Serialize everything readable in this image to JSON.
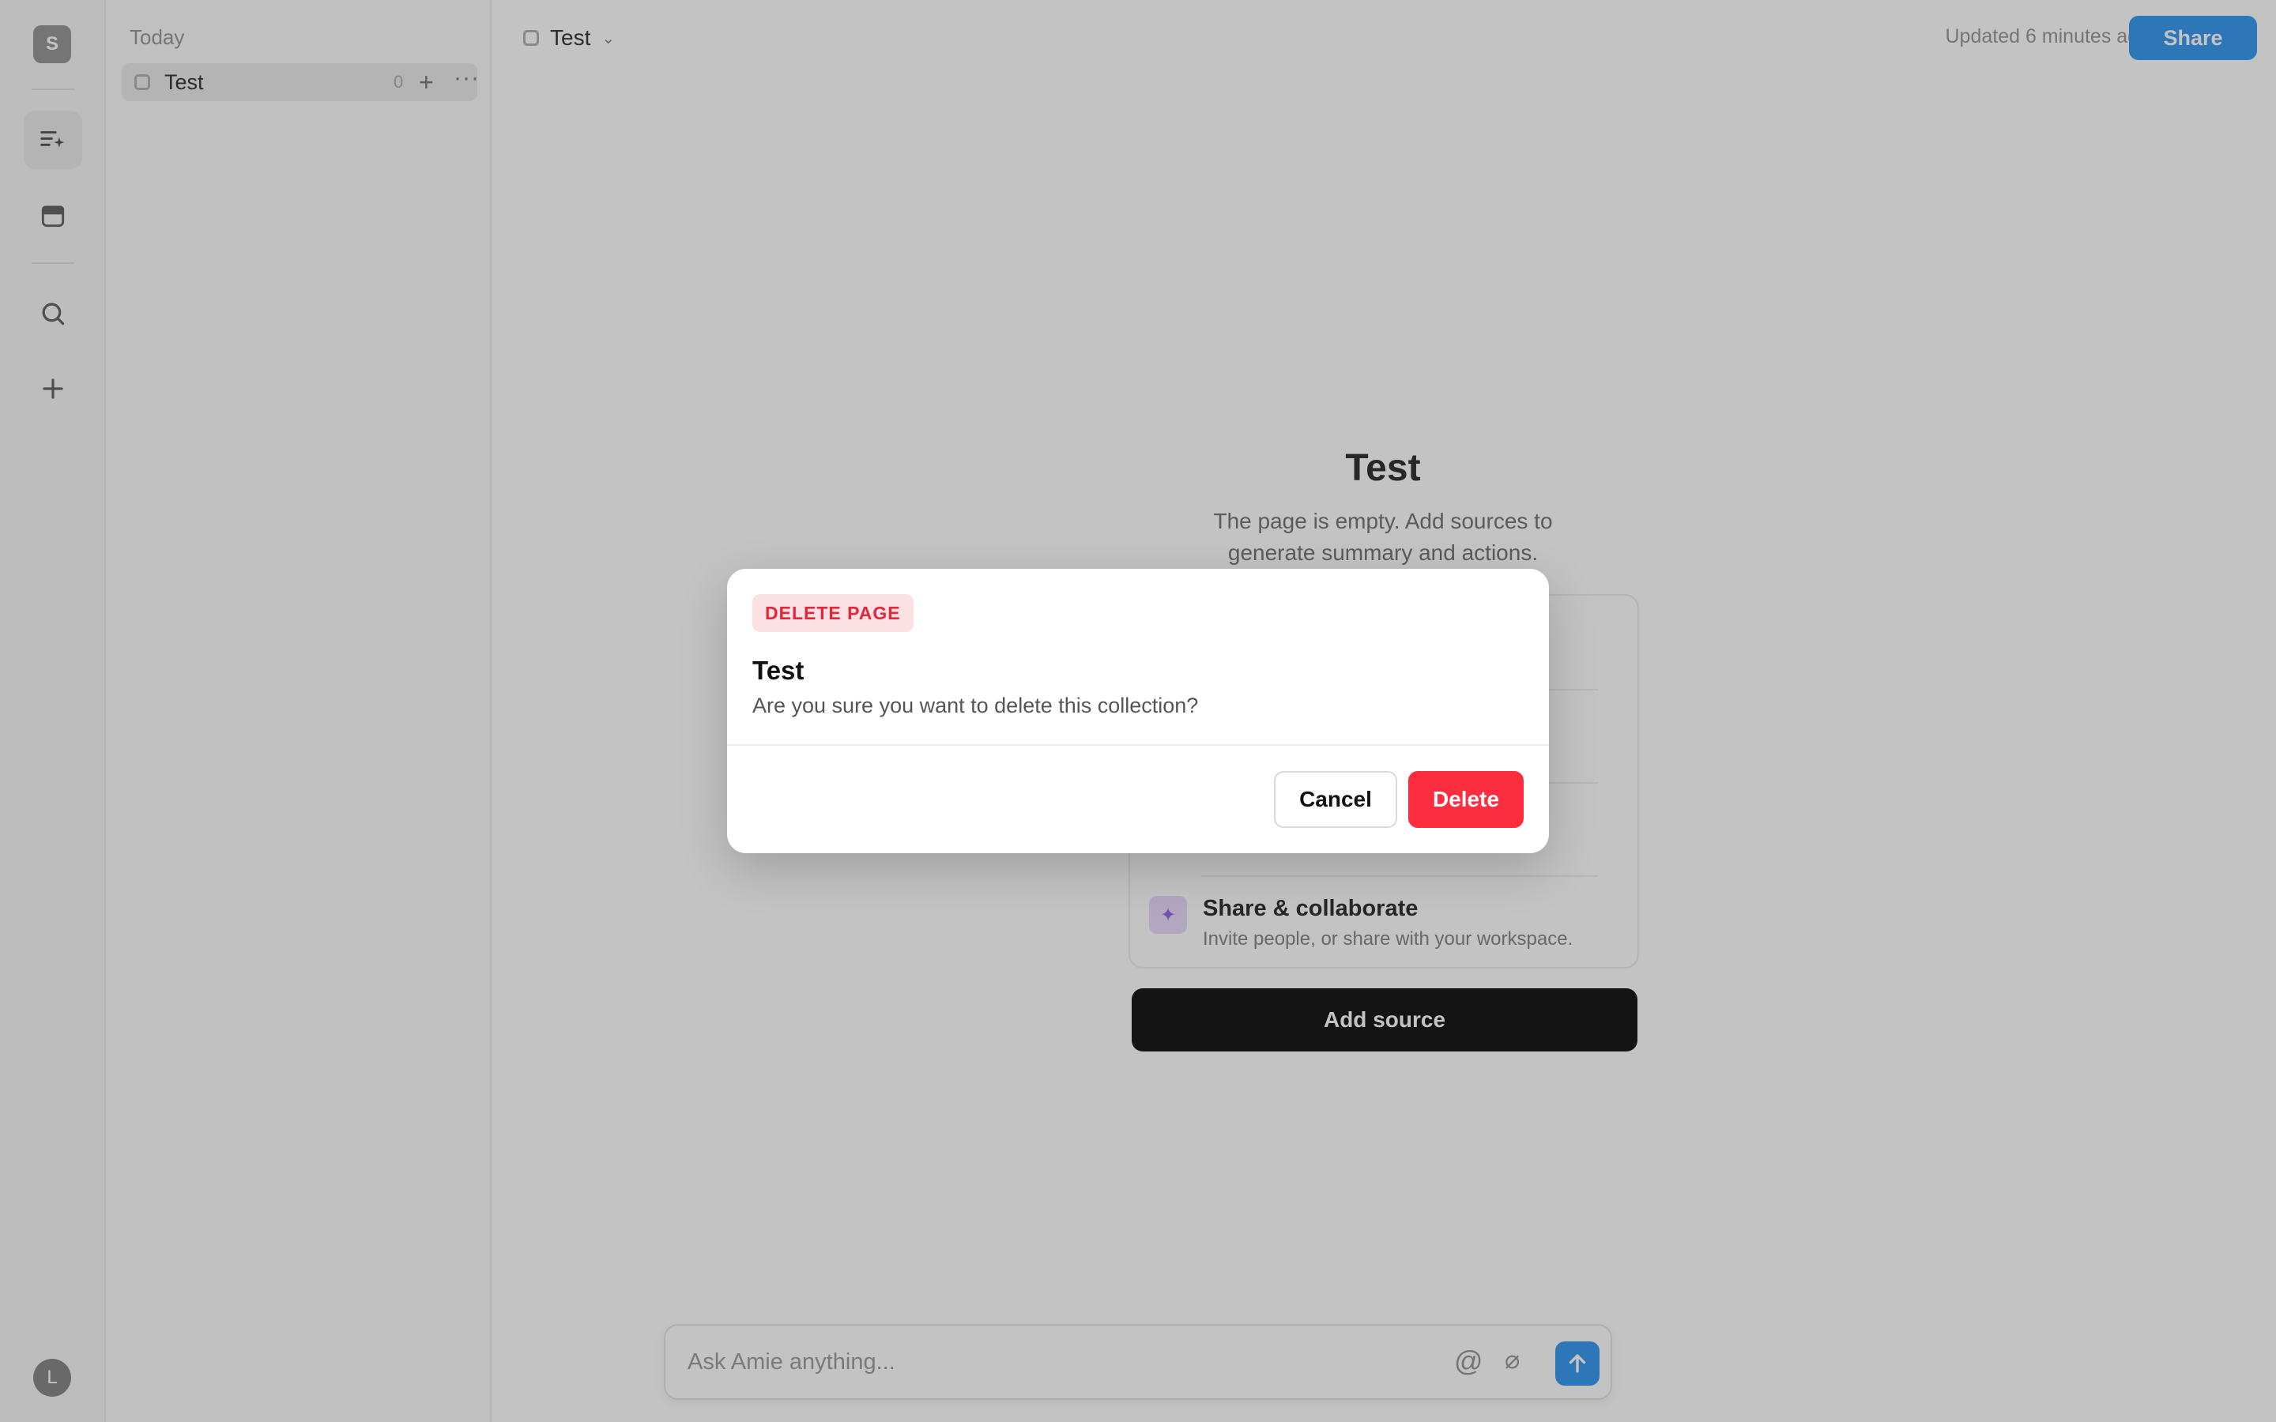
{
  "rail": {
    "workspace_initial": "S",
    "user_initial": "L",
    "icons": [
      "sparkle-list-icon",
      "calendar-icon",
      "search-icon",
      "plus-icon"
    ]
  },
  "sidebar": {
    "section_label": "Today",
    "items": [
      {
        "label": "Test",
        "count": "0"
      }
    ]
  },
  "topbar": {
    "title": "Test",
    "updated": "Updated 6 minutes ago",
    "share_label": "Share"
  },
  "empty_state": {
    "title": "Test",
    "subtitle": "The page is empty. Add sources to generate summary and actions.",
    "feature_title": "Share & collaborate",
    "feature_subtitle": "Invite people, or share with your workspace.",
    "add_source_label": "Add source"
  },
  "composer": {
    "placeholder": "Ask Amie anything..."
  },
  "modal": {
    "badge": "DELETE PAGE",
    "heading": "Test",
    "question": "Are you sure you want to delete this collection?",
    "cancel_label": "Cancel",
    "delete_label": "Delete"
  },
  "colors": {
    "accent_blue": "#3b9cf1",
    "danger_red": "#fb2d3f",
    "danger_badge_bg": "#fde0e3",
    "overlay": "rgba(0,0,0,0.235)"
  }
}
